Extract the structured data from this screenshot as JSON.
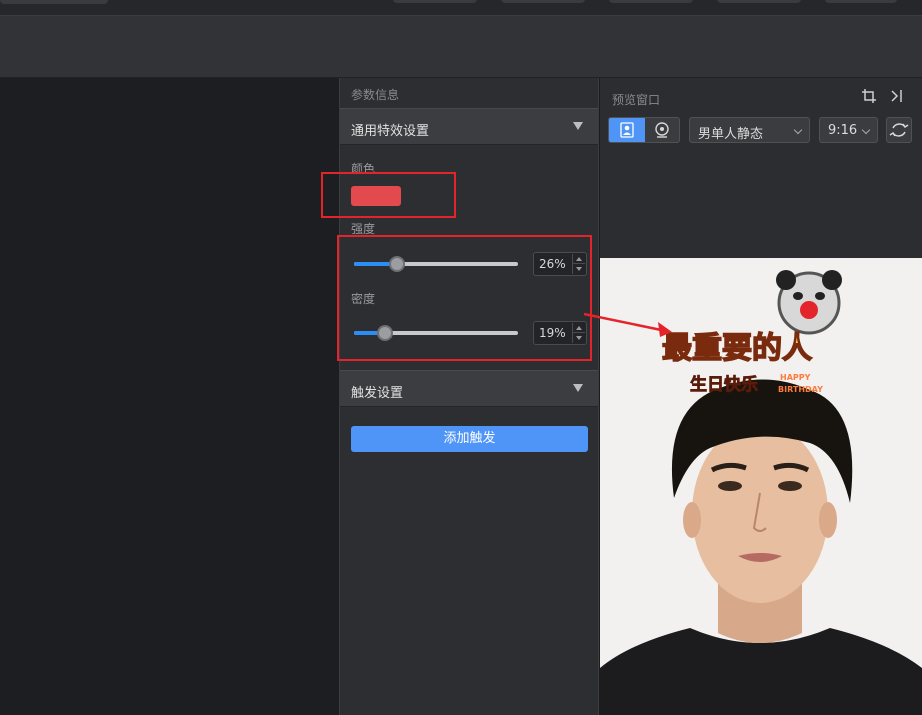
{
  "params_panel": {
    "title": "参数信息",
    "general_section": {
      "label": "通用特效设置",
      "color_label": "颜色",
      "color_value": "#e24a4d",
      "intensity_label": "强度",
      "intensity_value": "26%",
      "intensity_fraction": 0.26,
      "density_label": "密度",
      "density_value": "19%",
      "density_fraction": 0.19
    },
    "trigger_section": {
      "label": "触发设置",
      "add_button": "添加触发"
    }
  },
  "preview_panel": {
    "title": "预览窗口",
    "model_select": "男单人静态",
    "ratio_select": "9:16",
    "effect_text_main": "最重要的人",
    "effect_text_sub": "生日快乐",
    "effect_text_happy": "HAPPY",
    "effect_text_birthday": "BIRTHDAY"
  },
  "colors": {
    "accent": "#4f94f7",
    "annotation": "#e3242b",
    "swatch": "#e24a4d"
  },
  "icons": [
    "crop-icon",
    "collapse-right-icon",
    "portrait-icon",
    "webcam-icon",
    "refresh-icon"
  ]
}
